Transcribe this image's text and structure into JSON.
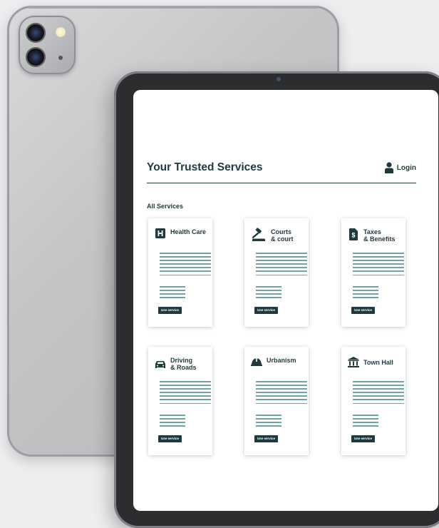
{
  "app": {
    "title": "Your Trusted Services",
    "login_label": "Login",
    "section_label": "All Services"
  },
  "services": [
    {
      "name": "Health Care",
      "icon": "hospital-icon",
      "button": "Use service"
    },
    {
      "name": "Courts\n& court",
      "icon": "gavel-icon",
      "button": "Use service"
    },
    {
      "name": "Taxes\n& Benefits",
      "icon": "dollar-document-icon",
      "button": "Use service"
    },
    {
      "name": "Driving\n& Roads",
      "icon": "car-icon",
      "button": "Use service"
    },
    {
      "name": "Urbanism",
      "icon": "helmet-icon",
      "button": "Use service"
    },
    {
      "name": "Town Hall",
      "icon": "town-hall-icon",
      "button": "Use service"
    }
  ],
  "colors": {
    "primary": "#1f3a3d",
    "accent_lines": "#6fa3a8"
  }
}
